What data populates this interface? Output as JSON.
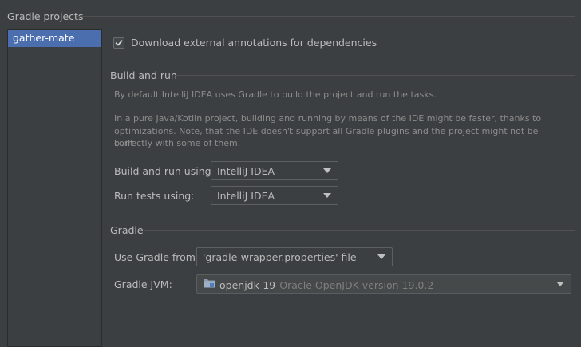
{
  "header": {
    "title": "Gradle projects"
  },
  "projects": [
    {
      "label": "gather-mate"
    }
  ],
  "annotations": {
    "label": "Download external annotations for dependencies",
    "checked": true
  },
  "build_and_run": {
    "title": "Build and run",
    "desc1": "By default IntelliJ IDEA uses Gradle to build the project and run the tasks.",
    "desc2_line1": "In a pure Java/Kotlin project, building and running by means of the IDE might be faster, thanks to",
    "desc2_line2": "optimizations. Note, that the IDE doesn't support all Gradle plugins and the project might not be built",
    "desc2_line3": "correctly with some of them.",
    "build_label": "Build and run using:",
    "build_value": "IntelliJ IDEA",
    "tests_label": "Run tests using:",
    "tests_value": "IntelliJ IDEA"
  },
  "gradle": {
    "title": "Gradle",
    "use_from_label": "Use Gradle from:",
    "use_from_value": "'gradle-wrapper.properties' file",
    "jvm_label": "Gradle JVM:",
    "jvm_name": "openjdk-19",
    "jvm_desc": "Oracle OpenJDK version 19.0.2"
  },
  "colors": {
    "background": "#3c3f41",
    "selection": "#4b6eaf",
    "text": "#bbbbbb",
    "muted": "#8c8c8c"
  }
}
